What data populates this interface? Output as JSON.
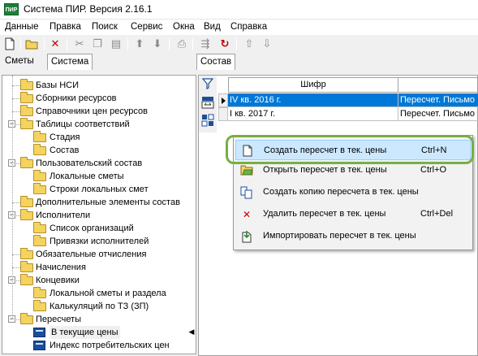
{
  "window": {
    "title": "Система ПИР. Версия 2.16.1",
    "icon_text": "ПИР"
  },
  "menu": [
    "Данные",
    "Правка",
    "Поиск",
    "Сервис",
    "Окна",
    "Вид",
    "Справка"
  ],
  "toolbar_icons": [
    "new-doc-icon",
    "open-folder-icon",
    "delete-icon",
    "cut-icon",
    "copy-icon",
    "paste-icon",
    "arrow-up-icon",
    "arrow-down-icon",
    "print-icon",
    "export-icon",
    "refresh-icon",
    "upload-icon",
    "download-icon"
  ],
  "left_tabs": [
    "Сметы",
    "Система"
  ],
  "right_tabs": [
    "Состав"
  ],
  "tree": [
    {
      "label": "Базы НСИ",
      "level": 1,
      "expander": ""
    },
    {
      "label": "Сборники ресурсов",
      "level": 1,
      "expander": ""
    },
    {
      "label": "Справочники цен ресурсов",
      "level": 1,
      "expander": ""
    },
    {
      "label": "Таблицы соответствий",
      "level": 1,
      "expander": "−"
    },
    {
      "label": "Стадия",
      "level": 2,
      "expander": ""
    },
    {
      "label": "Состав",
      "level": 2,
      "expander": ""
    },
    {
      "label": "Пользовательский состав",
      "level": 1,
      "expander": "−"
    },
    {
      "label": "Локальные сметы",
      "level": 2,
      "expander": ""
    },
    {
      "label": "Строки локальных смет",
      "level": 2,
      "expander": ""
    },
    {
      "label": "Дополнительные элементы состав",
      "level": 1,
      "expander": ""
    },
    {
      "label": "Исполнители",
      "level": 1,
      "expander": "−"
    },
    {
      "label": "Список организаций",
      "level": 2,
      "expander": ""
    },
    {
      "label": "Привязки исполнителей",
      "level": 2,
      "expander": ""
    },
    {
      "label": "Обязательные отчисления",
      "level": 1,
      "expander": ""
    },
    {
      "label": "Начисления",
      "level": 1,
      "expander": ""
    },
    {
      "label": "Концевики",
      "level": 1,
      "expander": "−"
    },
    {
      "label": "Локальной сметы и раздела",
      "level": 2,
      "expander": ""
    },
    {
      "label": "Калькуляций по ТЗ (ЗП)",
      "level": 2,
      "expander": ""
    },
    {
      "label": "Пересчеты",
      "level": 1,
      "expander": "−"
    },
    {
      "label": "В текущие цены",
      "level": 2,
      "expander": "",
      "icon": "calc",
      "selected": true
    },
    {
      "label": "Индекс потребительских цен",
      "level": 2,
      "expander": "",
      "icon": "calc"
    }
  ],
  "grid": {
    "columns": [
      "Шифр",
      ""
    ],
    "rows": [
      {
        "code": "IV кв. 2016 г.",
        "note": "Пересчет. Письмо",
        "selected": true,
        "current": true
      },
      {
        "code": "I кв. 2017 г.",
        "note": "Пересчет. Письмо",
        "selected": false,
        "current": false
      }
    ]
  },
  "context_menu": [
    {
      "label": "Создать пересчет в тек. цены",
      "shortcut": "Ctrl+N",
      "icon": "new-doc-icon",
      "hover": true
    },
    {
      "label": "Открыть пересчет в тек. цены",
      "shortcut": "Ctrl+O",
      "icon": "open-folder-icon"
    },
    {
      "label": "Создать копию пересчета в тек. цены",
      "shortcut": "",
      "icon": "copy-doc-icon"
    },
    {
      "label": "Удалить пересчет в тек. цены",
      "shortcut": "Ctrl+Del",
      "icon": "delete-icon"
    },
    {
      "label": "Импортировать пересчет в тек. цены",
      "shortcut": "",
      "icon": "import-icon"
    }
  ],
  "colors": {
    "selection": "#0078d7",
    "hover": "#cce8ff",
    "ring": "#76b041",
    "folder": "#f4d35e"
  }
}
